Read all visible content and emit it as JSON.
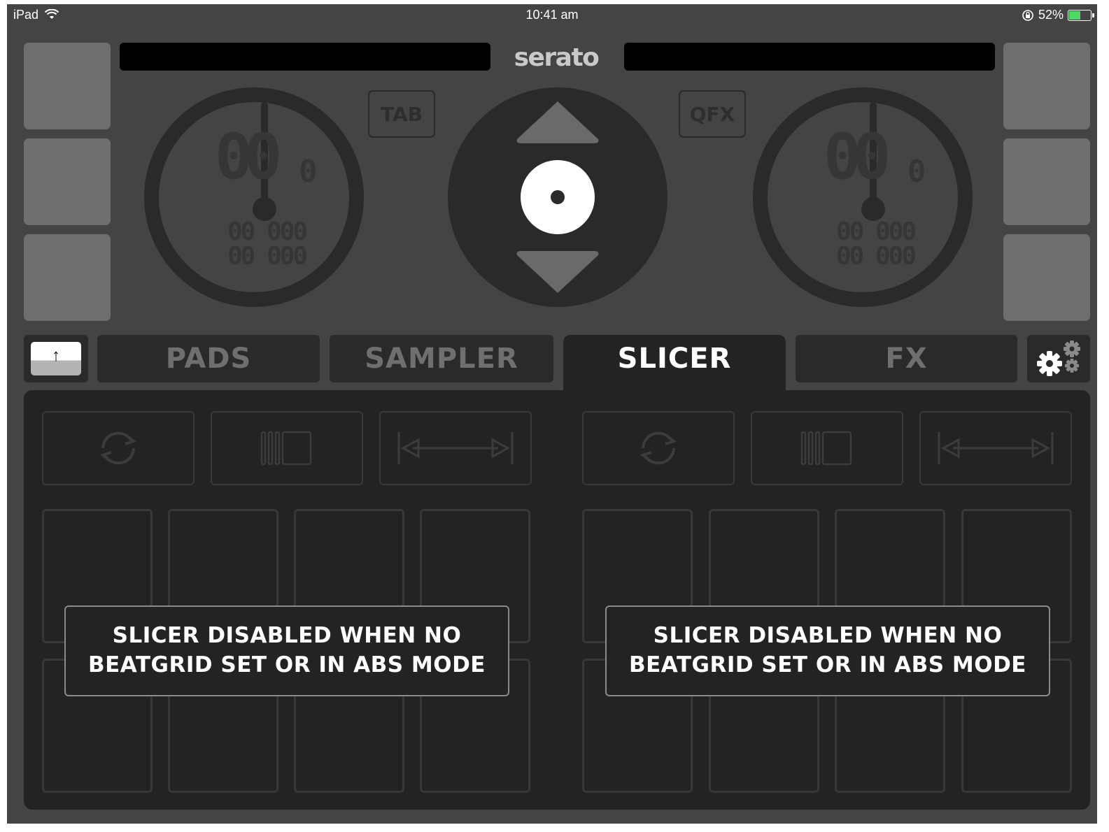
{
  "status_bar": {
    "device": "iPad",
    "wifi_icon": "wifi-icon",
    "time": "10:41 am",
    "rotation_lock_icon": "rotation-lock-icon",
    "battery_percent": "52%",
    "battery_level": 0.52
  },
  "header": {
    "logo": "serato",
    "left_track_title": "",
    "right_track_title": ""
  },
  "decks": {
    "left": {
      "big_number": "00",
      "small_number": "0",
      "row1": "00 000",
      "row2": "00 000",
      "mode_button": "TAB"
    },
    "right": {
      "big_number": "00",
      "small_number": "0",
      "row1": "00 000",
      "row2": "00 000",
      "mode_button": "QFX"
    }
  },
  "tabs": {
    "items": [
      {
        "label": "PADS",
        "active": false
      },
      {
        "label": "SAMPLER",
        "active": false
      },
      {
        "label": "SLICER",
        "active": true
      },
      {
        "label": "FX",
        "active": false
      }
    ],
    "shift_glyph": "↑"
  },
  "slicer": {
    "left_message": "SLICER DISABLED WHEN NO BEATGRID SET OR IN ABS MODE",
    "right_message": "SLICER DISABLED WHEN NO BEATGRID SET OR IN ABS MODE",
    "control_icons": [
      "loop-icon",
      "slice-domain-icon",
      "range-icon"
    ]
  },
  "colors": {
    "background": "#444446",
    "panel": "#232324",
    "pad_border": "#38383a",
    "battery": "#4cd964"
  }
}
